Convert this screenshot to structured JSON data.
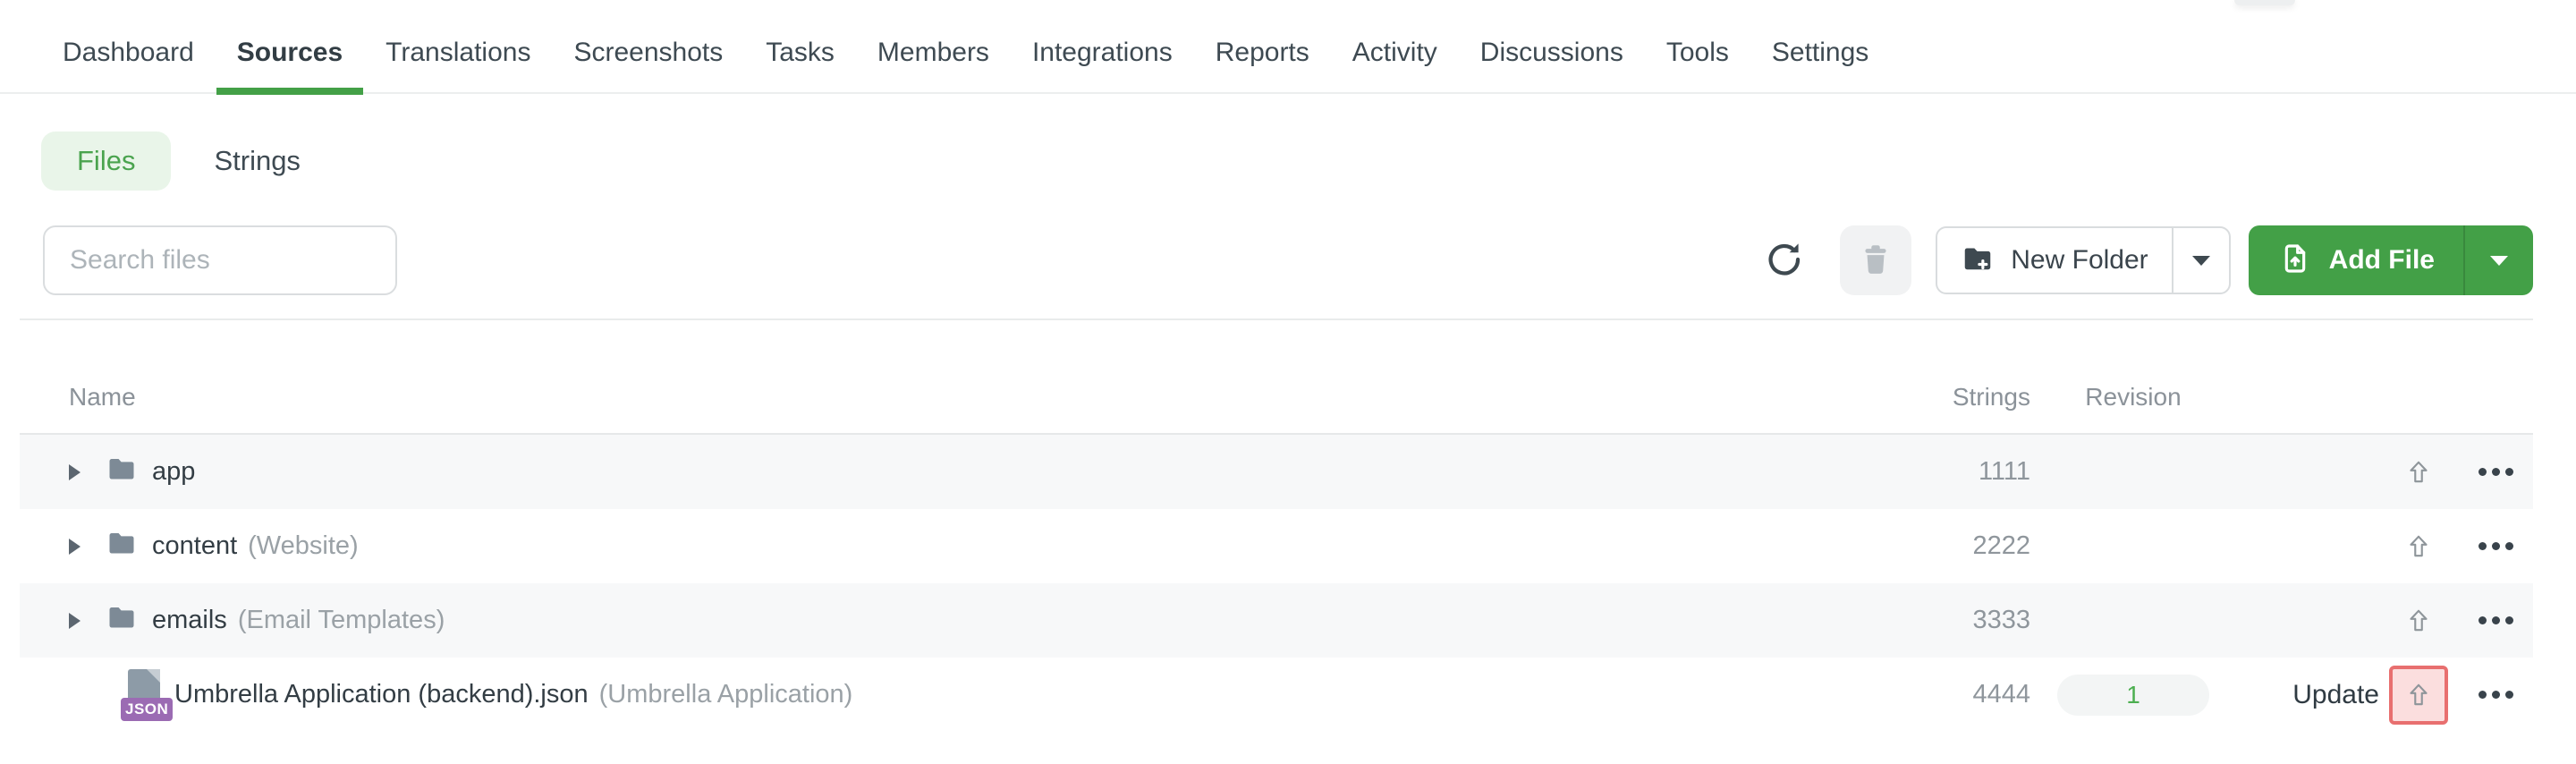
{
  "nav": {
    "items": [
      {
        "label": "Dashboard"
      },
      {
        "label": "Sources"
      },
      {
        "label": "Translations"
      },
      {
        "label": "Screenshots"
      },
      {
        "label": "Tasks"
      },
      {
        "label": "Members"
      },
      {
        "label": "Integrations"
      },
      {
        "label": "Reports"
      },
      {
        "label": "Activity"
      },
      {
        "label": "Discussions"
      },
      {
        "label": "Tools"
      },
      {
        "label": "Settings"
      }
    ],
    "active": "Sources"
  },
  "view_tabs": {
    "files": "Files",
    "strings": "Strings"
  },
  "toolbar": {
    "search_placeholder": "Search files",
    "new_folder_label": "New Folder",
    "add_file_label": "Add File"
  },
  "icons": {
    "refresh": "circular-arrow",
    "trash": "trash-can",
    "folder_plus": "folder-with-plus",
    "file_add": "document-with-up-arrow",
    "caret_down": "▾",
    "row_caret": "▸",
    "folder": "filled-folder",
    "json_file": "document-with-JSON-badge",
    "upload": "⇧",
    "row_menu": "•••"
  },
  "table": {
    "columns": {
      "name": "Name",
      "strings": "Strings",
      "revision": "Revision"
    },
    "rows": [
      {
        "type": "folder",
        "name": "app",
        "title": "",
        "strings": "1111"
      },
      {
        "type": "folder",
        "name": "content",
        "title": "(Website)",
        "strings": "2222"
      },
      {
        "type": "folder",
        "name": "emails",
        "title": "(Email Templates)",
        "strings": "3333"
      },
      {
        "type": "file",
        "name": "Umbrella Application (backend).json",
        "title": "(Umbrella Application)",
        "strings": "4444",
        "revision": "1",
        "update_label": "Update",
        "file_badge": "JSON",
        "highlighted": true
      }
    ]
  },
  "colors": {
    "accent_green": "#43a047",
    "files_pill_bg": "#e9f5e9",
    "row_alt_bg": "#f7f8f9",
    "revision_badge_text": "#4caf50",
    "highlight_border": "#e86f6f",
    "highlight_bg": "#fbdede",
    "json_badge_purple": "#9b6bb3",
    "muted_text": "#8f969c"
  }
}
